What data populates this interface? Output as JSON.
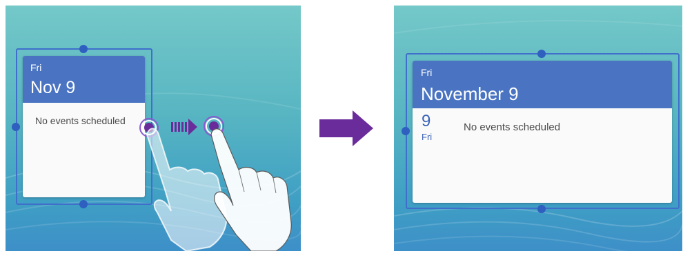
{
  "before": {
    "widget": {
      "day": "Fri",
      "date": "Nov 9",
      "empty_message": "No events scheduled"
    }
  },
  "after": {
    "widget": {
      "day": "Fri",
      "date": "November 9",
      "day_number": "9",
      "day_short": "Fri",
      "empty_message": "No events scheduled"
    }
  },
  "colors": {
    "header_blue": "#4a74c2",
    "frame_blue": "#3f6fcb",
    "arrow_purple": "#6a2c9a"
  },
  "icons": [
    "finger-gesture-icon",
    "drag-arrow-icon",
    "transition-arrow-icon"
  ]
}
